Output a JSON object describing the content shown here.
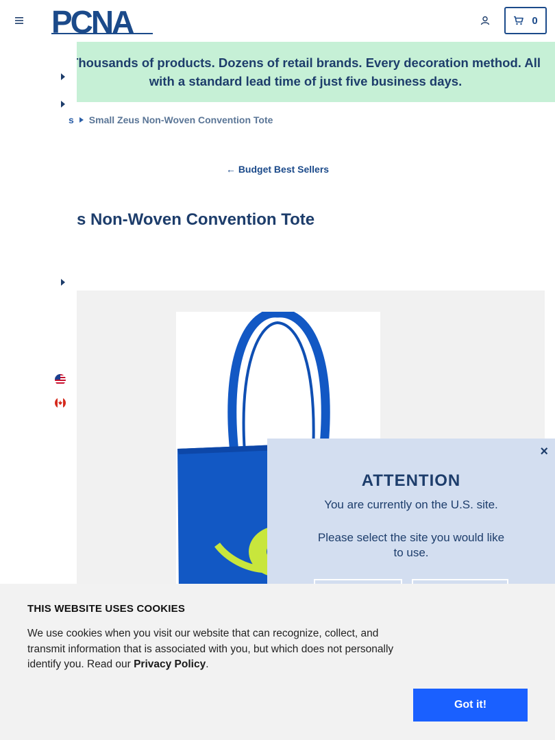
{
  "header": {
    "logo_text": "PCNA",
    "cart_count": "0",
    "brand_color": "#1b4a8a"
  },
  "banner": {
    "text": "Thousands of products. Dozens of retail brands. Every decoration method. All with a standard lead time of just five business days.",
    "background": "#c6f0d6"
  },
  "breadcrumb": {
    "partial_link": "s",
    "current": "Small Zeus Non-Woven Convention Tote"
  },
  "back_link": {
    "label": "Budget Best Sellers"
  },
  "product": {
    "title_visible": "eus Non-Woven Convention Tote",
    "tote_color": "#1258c4",
    "logo_color": "#c8e63c"
  },
  "side_menu": {
    "flags": [
      "us-flag-icon",
      "canada-flag-icon"
    ]
  },
  "attention_modal": {
    "close_label": "×",
    "heading": "ATTENTION",
    "message": "You are currently on the U.S. site.",
    "prompt": "Please select the site you would like to use."
  },
  "cookie_banner": {
    "heading": "THIS WEBSITE USES COOKIES",
    "text_before": "We use cookies when you visit our website that can recognize, collect, and transmit information that is associated with you, but which does not personally identify you. Read our ",
    "policy_link": "Privacy Policy",
    "text_after": ".",
    "accept_label": "Got it!",
    "accept_color": "#1a60ff"
  }
}
